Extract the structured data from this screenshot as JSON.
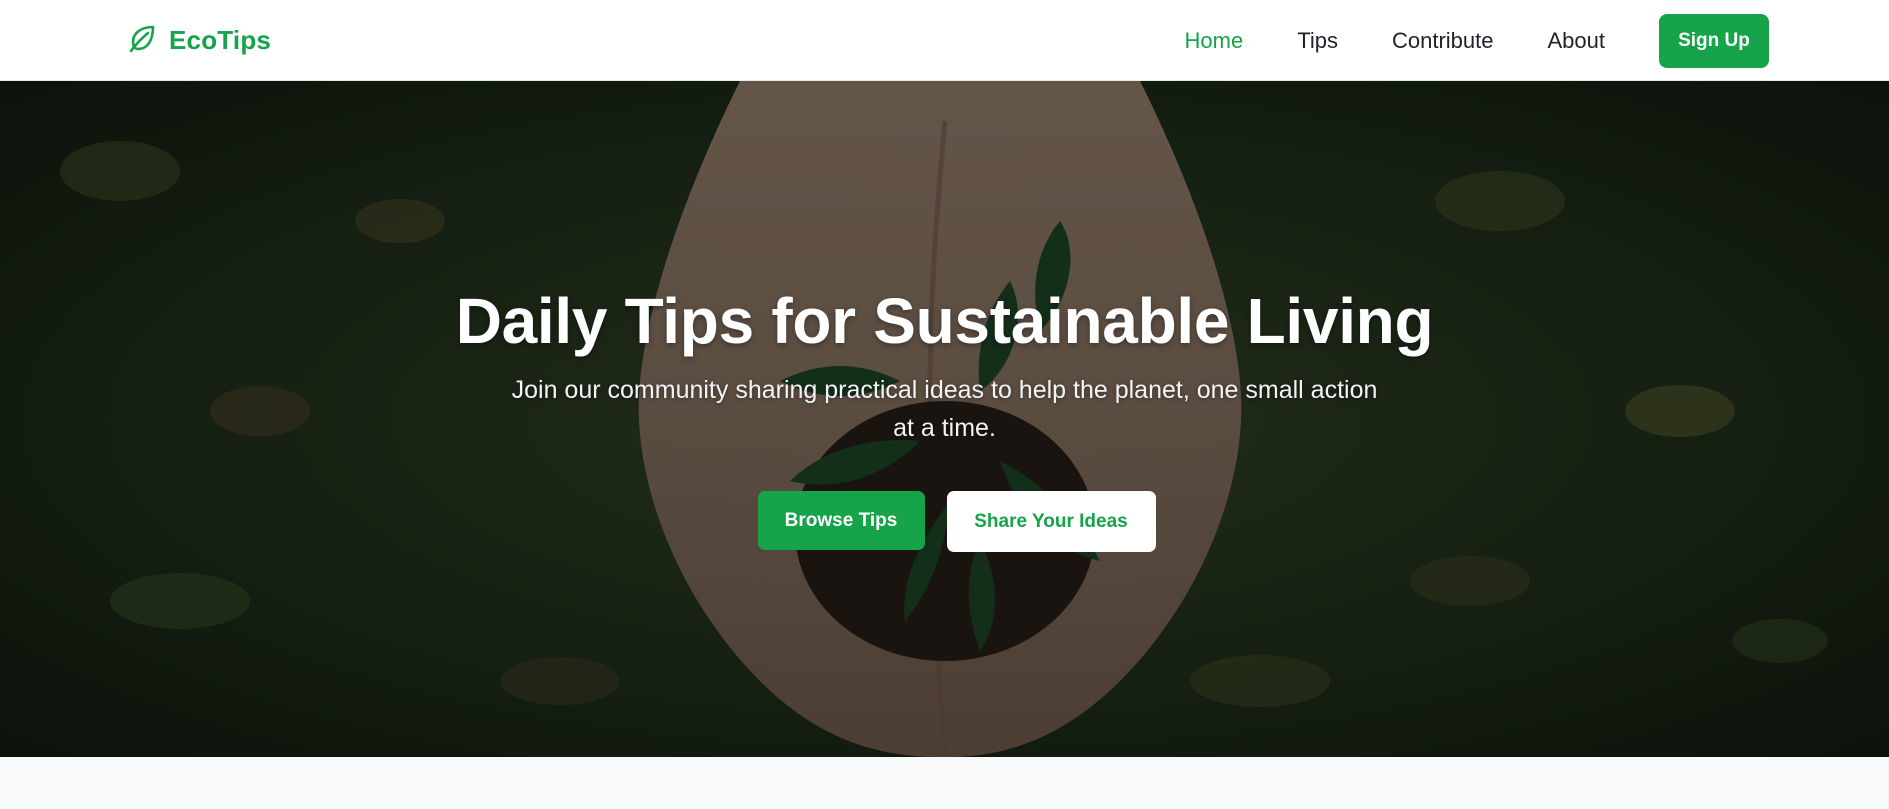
{
  "brand": {
    "name": "EcoTips",
    "icon": "leaf-icon",
    "color": "#16a34a"
  },
  "nav": {
    "items": [
      {
        "label": "Home",
        "active": true
      },
      {
        "label": "Tips",
        "active": false
      },
      {
        "label": "Contribute",
        "active": false
      },
      {
        "label": "About",
        "active": false
      }
    ],
    "signup_label": "Sign Up"
  },
  "hero": {
    "title": "Daily Tips for Sustainable Living",
    "subtitle": "Join our community sharing practical ideas to help the planet, one small action at a time.",
    "primary_button": "Browse Tips",
    "secondary_button": "Share Your Ideas",
    "image_subject": "hands-holding-seedling"
  },
  "colors": {
    "accent": "#16a34a",
    "nav_text": "#1f2328",
    "page_background": "#f8f9fb"
  }
}
